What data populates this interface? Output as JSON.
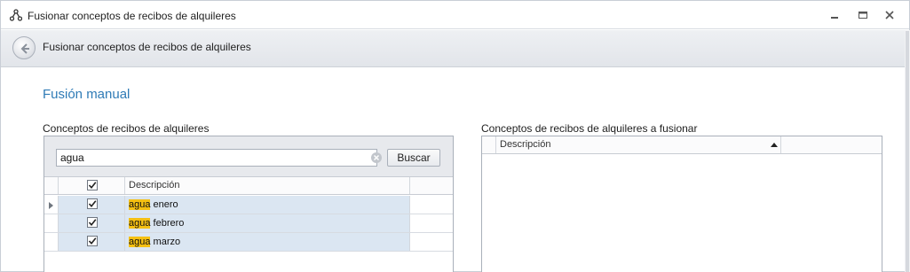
{
  "window": {
    "title": "Fusionar conceptos de recibos de alquileres",
    "app_icon": "network-nodes-icon",
    "controls": [
      "minimize-icon",
      "maximize-icon",
      "close-icon"
    ]
  },
  "header": {
    "back_icon": "back-arrow-icon",
    "title": "Fusionar conceptos de recibos de alquileres"
  },
  "section_title": "Fusión manual",
  "left": {
    "label": "Conceptos de recibos de alquileres",
    "search": {
      "value": "agua",
      "button_label": "Buscar",
      "clear_icon": "clear-icon"
    },
    "columns": [
      "",
      "",
      "Descripción"
    ],
    "header_checked": true,
    "rows": [
      {
        "checked": true,
        "match": "agua",
        "rest": " enero",
        "current": true
      },
      {
        "checked": true,
        "match": "agua",
        "rest": " febrero",
        "current": false
      },
      {
        "checked": true,
        "match": "agua",
        "rest": " marzo",
        "current": false
      }
    ]
  },
  "right": {
    "label": "Conceptos de recibos de alquileres a fusionar",
    "columns": [
      "",
      "Descripción"
    ],
    "sort_direction": "ascending"
  },
  "colors": {
    "accent": "#2f7bb6",
    "highlight": "#f5c013",
    "row_selected": "#dbe6f2"
  }
}
